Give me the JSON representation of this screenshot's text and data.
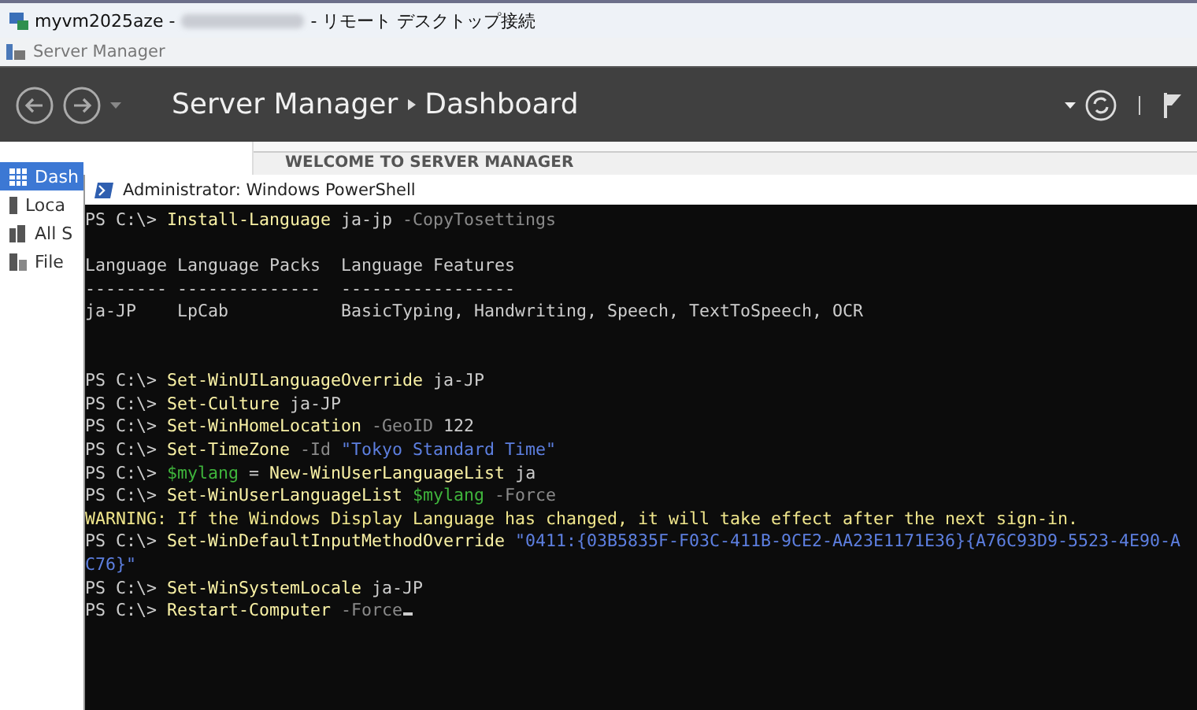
{
  "rdp_window": {
    "title_host": "myvm2025aze -",
    "title_suffix": "- リモート デスクトップ接続"
  },
  "app_window": {
    "title": "Server Manager"
  },
  "header": {
    "breadcrumb": [
      "Server Manager",
      "Dashboard"
    ]
  },
  "sidebar": {
    "items": [
      {
        "label": "Dash",
        "selected": true,
        "kind": "dashboard"
      },
      {
        "label": "Loca",
        "selected": false,
        "kind": "server"
      },
      {
        "label": "All S",
        "selected": false,
        "kind": "servers"
      },
      {
        "label": "File",
        "selected": false,
        "kind": "files"
      }
    ]
  },
  "main": {
    "heading": "WELCOME TO SERVER MANAGER"
  },
  "powershell": {
    "title": "Administrator: Windows PowerShell",
    "cursor_visible": true,
    "blocks": [
      {
        "kind": "commands",
        "lines": [
          [
            {
              "kind": "prompt",
              "text": "PS C:\\> "
            },
            {
              "kind": "command",
              "text": "Install-Language"
            },
            {
              "kind": "text",
              "text": " ja-jp "
            },
            {
              "kind": "param",
              "text": "-CopyTosettings"
            }
          ]
        ]
      },
      {
        "kind": "output",
        "lines": [
          [
            {
              "kind": "text",
              "text": "Language Language Packs  Language Features"
            }
          ],
          [
            {
              "kind": "text",
              "text": "-------- --------------  -----------------"
            }
          ],
          [
            {
              "kind": "text",
              "text": "ja-JP    LpCab           BasicTyping, Handwriting, Speech, TextToSpeech, OCR"
            }
          ]
        ]
      },
      {
        "kind": "commands",
        "lines": [
          [
            {
              "kind": "prompt",
              "text": "PS C:\\> "
            },
            {
              "kind": "command",
              "text": "Set-WinUILanguageOverride"
            },
            {
              "kind": "text",
              "text": " ja-JP"
            }
          ],
          [
            {
              "kind": "prompt",
              "text": "PS C:\\> "
            },
            {
              "kind": "command",
              "text": "Set-Culture"
            },
            {
              "kind": "text",
              "text": " ja-JP"
            }
          ],
          [
            {
              "kind": "prompt",
              "text": "PS C:\\> "
            },
            {
              "kind": "command",
              "text": "Set-WinHomeLocation"
            },
            {
              "kind": "param",
              "text": " -GeoID"
            },
            {
              "kind": "text",
              "text": " 122"
            }
          ],
          [
            {
              "kind": "prompt",
              "text": "PS C:\\> "
            },
            {
              "kind": "command",
              "text": "Set-TimeZone"
            },
            {
              "kind": "param",
              "text": " -Id"
            },
            {
              "kind": "string",
              "text": " \"Tokyo Standard Time\""
            }
          ],
          [
            {
              "kind": "prompt",
              "text": "PS C:\\> "
            },
            {
              "kind": "variable",
              "text": "$mylang"
            },
            {
              "kind": "text",
              "text": " = "
            },
            {
              "kind": "command",
              "text": "New-WinUserLanguageList"
            },
            {
              "kind": "text",
              "text": " ja"
            }
          ],
          [
            {
              "kind": "prompt",
              "text": "PS C:\\> "
            },
            {
              "kind": "command",
              "text": "Set-WinUserLanguageList"
            },
            {
              "kind": "variable",
              "text": " $mylang"
            },
            {
              "kind": "param",
              "text": " -Force"
            }
          ],
          [
            {
              "kind": "warning",
              "text": "WARNING: If the Windows Display Language has changed, it will take effect after the next sign-in."
            }
          ],
          [
            {
              "kind": "prompt",
              "text": "PS C:\\> "
            },
            {
              "kind": "command",
              "text": "Set-WinDefaultInputMethodOverride"
            },
            {
              "kind": "string",
              "text": " \"0411:{03B5835F-F03C-411B-9CE2-AA23E1171E36}{A76C93D9-5523-4E90-A"
            }
          ],
          [
            {
              "kind": "string",
              "text": "C76}\""
            }
          ],
          [
            {
              "kind": "prompt",
              "text": "PS C:\\> "
            },
            {
              "kind": "command",
              "text": "Set-WinSystemLocale"
            },
            {
              "kind": "text",
              "text": " ja-JP"
            }
          ],
          [
            {
              "kind": "prompt",
              "text": "PS C:\\> "
            },
            {
              "kind": "command",
              "text": "Restart-Computer"
            },
            {
              "kind": "param",
              "text": " -Force"
            }
          ]
        ]
      }
    ]
  }
}
